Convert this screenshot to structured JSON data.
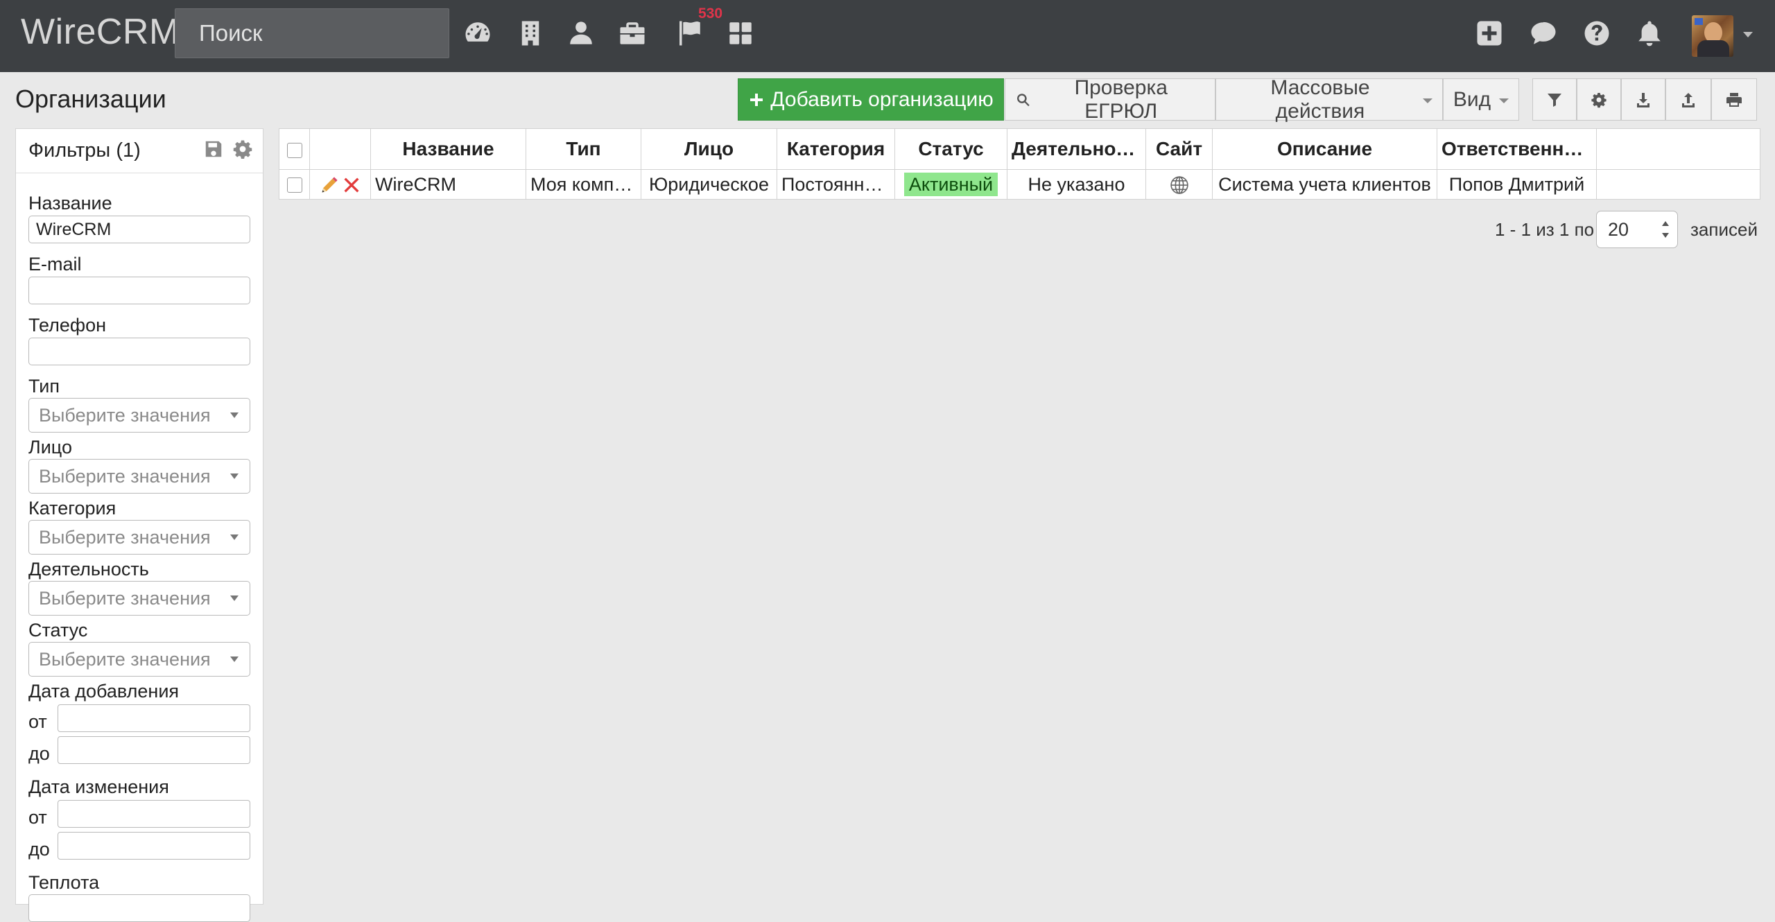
{
  "app": {
    "brand": "WireCRM"
  },
  "search": {
    "placeholder": "Поиск"
  },
  "nav": {
    "icons": [
      "dashboard-icon",
      "building-icon",
      "user-icon",
      "briefcase-icon",
      "flag-icon",
      "apps-icon"
    ],
    "flag_badge": "530",
    "right_icons": [
      "plus-square-icon",
      "chat-icon",
      "help-icon",
      "bell-icon"
    ]
  },
  "page": {
    "title": "Организации"
  },
  "toolbar": {
    "add_label": "Добавить организацию",
    "egrul_label": "Проверка ЕГРЮЛ",
    "bulk_label": "Массовые действия",
    "view_label": "Вид"
  },
  "filters": {
    "title": "Фильтры (1)",
    "name_label": "Название",
    "name_value": "WireCRM",
    "email_label": "E-mail",
    "phone_label": "Телефон",
    "select_placeholder": "Выберите значения",
    "type_label": "Тип",
    "person_label": "Лицо",
    "category_label": "Категория",
    "activity_label": "Деятельность",
    "status_label": "Статус",
    "date_added_label": "Дата добавления",
    "date_changed_label": "Дата изменения",
    "from_label": "от",
    "to_label": "до",
    "warmth_label": "Теплота"
  },
  "table": {
    "headers": {
      "name": "Название",
      "type": "Тип",
      "person": "Лицо",
      "category": "Категория",
      "status": "Статус",
      "activity": "Деятельность",
      "site": "Сайт",
      "description": "Описание",
      "responsible": "Ответственный"
    },
    "rows": [
      {
        "name": "WireCRM",
        "type": "Моя компания",
        "person": "Юридическое",
        "category": "Постоянный клиент",
        "status": "Активный",
        "activity": "Не указано",
        "description": "Система учета клиентов",
        "responsible": "Попов Дмитрий"
      }
    ]
  },
  "pager": {
    "range_text": "1 - 1 из 1 по",
    "per_page": "20",
    "suffix": "записей"
  },
  "colors": {
    "navbar": "#3d4043",
    "primary_button": "#40a447",
    "status_active": "#8fe68d",
    "badge": "#e0344a"
  }
}
